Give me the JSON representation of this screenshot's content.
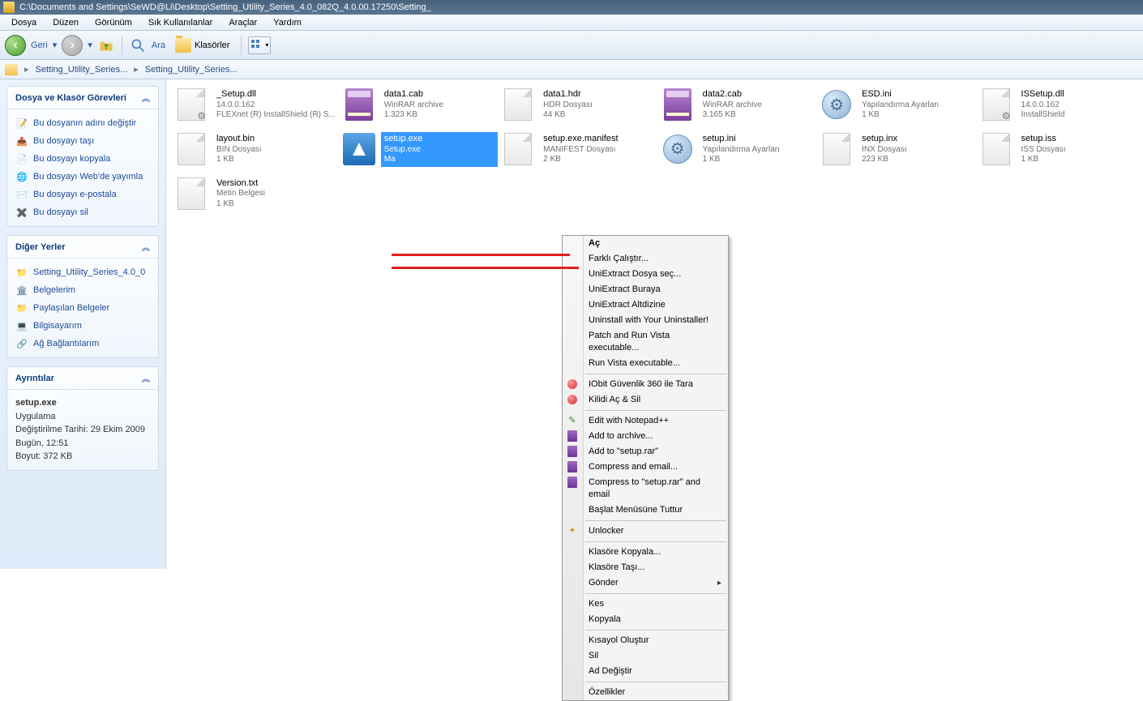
{
  "title": "C:\\Documents and Settings\\SeWD@Li\\Desktop\\Setting_Utility_Series_4.0_082Q_4.0.00.17250\\Setting_",
  "menu": [
    "Dosya",
    "Düzen",
    "Görünüm",
    "Sık Kullanılanlar",
    "Araçlar",
    "Yardım"
  ],
  "toolbar": {
    "back": "Geri",
    "search": "Ara",
    "folders": "Klasörler"
  },
  "breadcrumb": [
    "Setting_Utility_Series...",
    "Setting_Utility_Series..."
  ],
  "sidebar": {
    "tasks": {
      "title": "Dosya ve Klasör Görevleri",
      "items": [
        "Bu dosyanın adını değiştir",
        "Bu dosyayı taşı",
        "Bu dosyayı kopyala",
        "Bu dosyayı Web'de yayımla",
        "Bu dosyayı e-postala",
        "Bu dosyayı sil"
      ]
    },
    "places": {
      "title": "Diğer Yerler",
      "items": [
        "Setting_Utility_Series_4.0_0",
        "Belgelerim",
        "Paylaşılan Belgeler",
        "Bilgisayarım",
        "Ağ Bağlantılarım"
      ]
    },
    "details": {
      "title": "Ayrıntılar",
      "name": "setup.exe",
      "type": "Uygulama",
      "modLabel": "Değiştirilme Tarihi: 29 Ekim 2009 Bugün, 12:51",
      "sizeLabel": "Boyut: 372 KB"
    }
  },
  "files": [
    {
      "name": "_Setup.dll",
      "l1": "14.0.0.162",
      "l2": "FLEXnet (R) InstallShield (R) S...",
      "icon": "page-gear"
    },
    {
      "name": "data1.cab",
      "l1": "WinRAR archive",
      "l2": "1.323 KB",
      "icon": "rar"
    },
    {
      "name": "data1.hdr",
      "l1": "HDR Dosyası",
      "l2": "44 KB",
      "icon": "page"
    },
    {
      "name": "data2.cab",
      "l1": "WinRAR archive",
      "l2": "3.165 KB",
      "icon": "rar"
    },
    {
      "name": "ESD.ini",
      "l1": "Yapılandırma Ayarları",
      "l2": "1 KB",
      "icon": "ini"
    },
    {
      "name": "ISSetup.dll",
      "l1": "14.0.0.162",
      "l2": "InstallShield",
      "icon": "page-gear"
    },
    {
      "name": "layout.bin",
      "l1": "BIN Dosyası",
      "l2": "1 KB",
      "icon": "page"
    },
    {
      "name": "setup.exe",
      "l1": "Setup.exe",
      "l2": "Ma",
      "icon": "exe",
      "selected": true
    },
    {
      "name": "setup.exe.manifest",
      "l1": "MANIFEST Dosyası",
      "l2": "2 KB",
      "icon": "page"
    },
    {
      "name": "setup.ini",
      "l1": "Yapılandırma Ayarları",
      "l2": "1 KB",
      "icon": "ini"
    },
    {
      "name": "setup.inx",
      "l1": "INX Dosyası",
      "l2": "223 KB",
      "icon": "page"
    },
    {
      "name": "setup.iss",
      "l1": "ISS Dosyası",
      "l2": "1 KB",
      "icon": "page"
    },
    {
      "name": "Version.txt",
      "l1": "Metin Belgesi",
      "l2": "1 KB",
      "icon": "page"
    }
  ],
  "context_menu": [
    {
      "label": "Aç",
      "bold": true
    },
    {
      "label": "Farklı Çalıştır..."
    },
    {
      "label": "UniExtract Dosya seç..."
    },
    {
      "label": "UniExtract Buraya"
    },
    {
      "label": "UniExtract Altdizine"
    },
    {
      "label": "Uninstall with Your Uninstaller!"
    },
    {
      "label": "Patch and Run Vista executable..."
    },
    {
      "label": "Run Vista executable..."
    },
    {
      "sep": true
    },
    {
      "label": "IObit Güvenlik 360 ile Tara",
      "icon": "red"
    },
    {
      "label": "Kilidi Aç & Sil",
      "icon": "red"
    },
    {
      "sep": true
    },
    {
      "label": "Edit with Notepad++",
      "icon": "edit"
    },
    {
      "label": "Add to archive...",
      "icon": "rar"
    },
    {
      "label": "Add to \"setup.rar\"",
      "icon": "rar"
    },
    {
      "label": "Compress and email...",
      "icon": "rar"
    },
    {
      "label": "Compress to \"setup.rar\" and email",
      "icon": "rar"
    },
    {
      "label": "Başlat Menüsüne Tuttur"
    },
    {
      "sep": true
    },
    {
      "label": "Unlocker",
      "icon": "unlock"
    },
    {
      "sep": true
    },
    {
      "label": "Klasöre Kopyala..."
    },
    {
      "label": "Klasöre Taşı..."
    },
    {
      "label": "Gönder",
      "sub": true
    },
    {
      "sep": true
    },
    {
      "label": "Kes"
    },
    {
      "label": "Kopyala"
    },
    {
      "sep": true
    },
    {
      "label": "Kısayol Oluştur"
    },
    {
      "label": "Sil"
    },
    {
      "label": "Ad Değiştir"
    },
    {
      "sep": true
    },
    {
      "label": "Özellikler"
    }
  ]
}
